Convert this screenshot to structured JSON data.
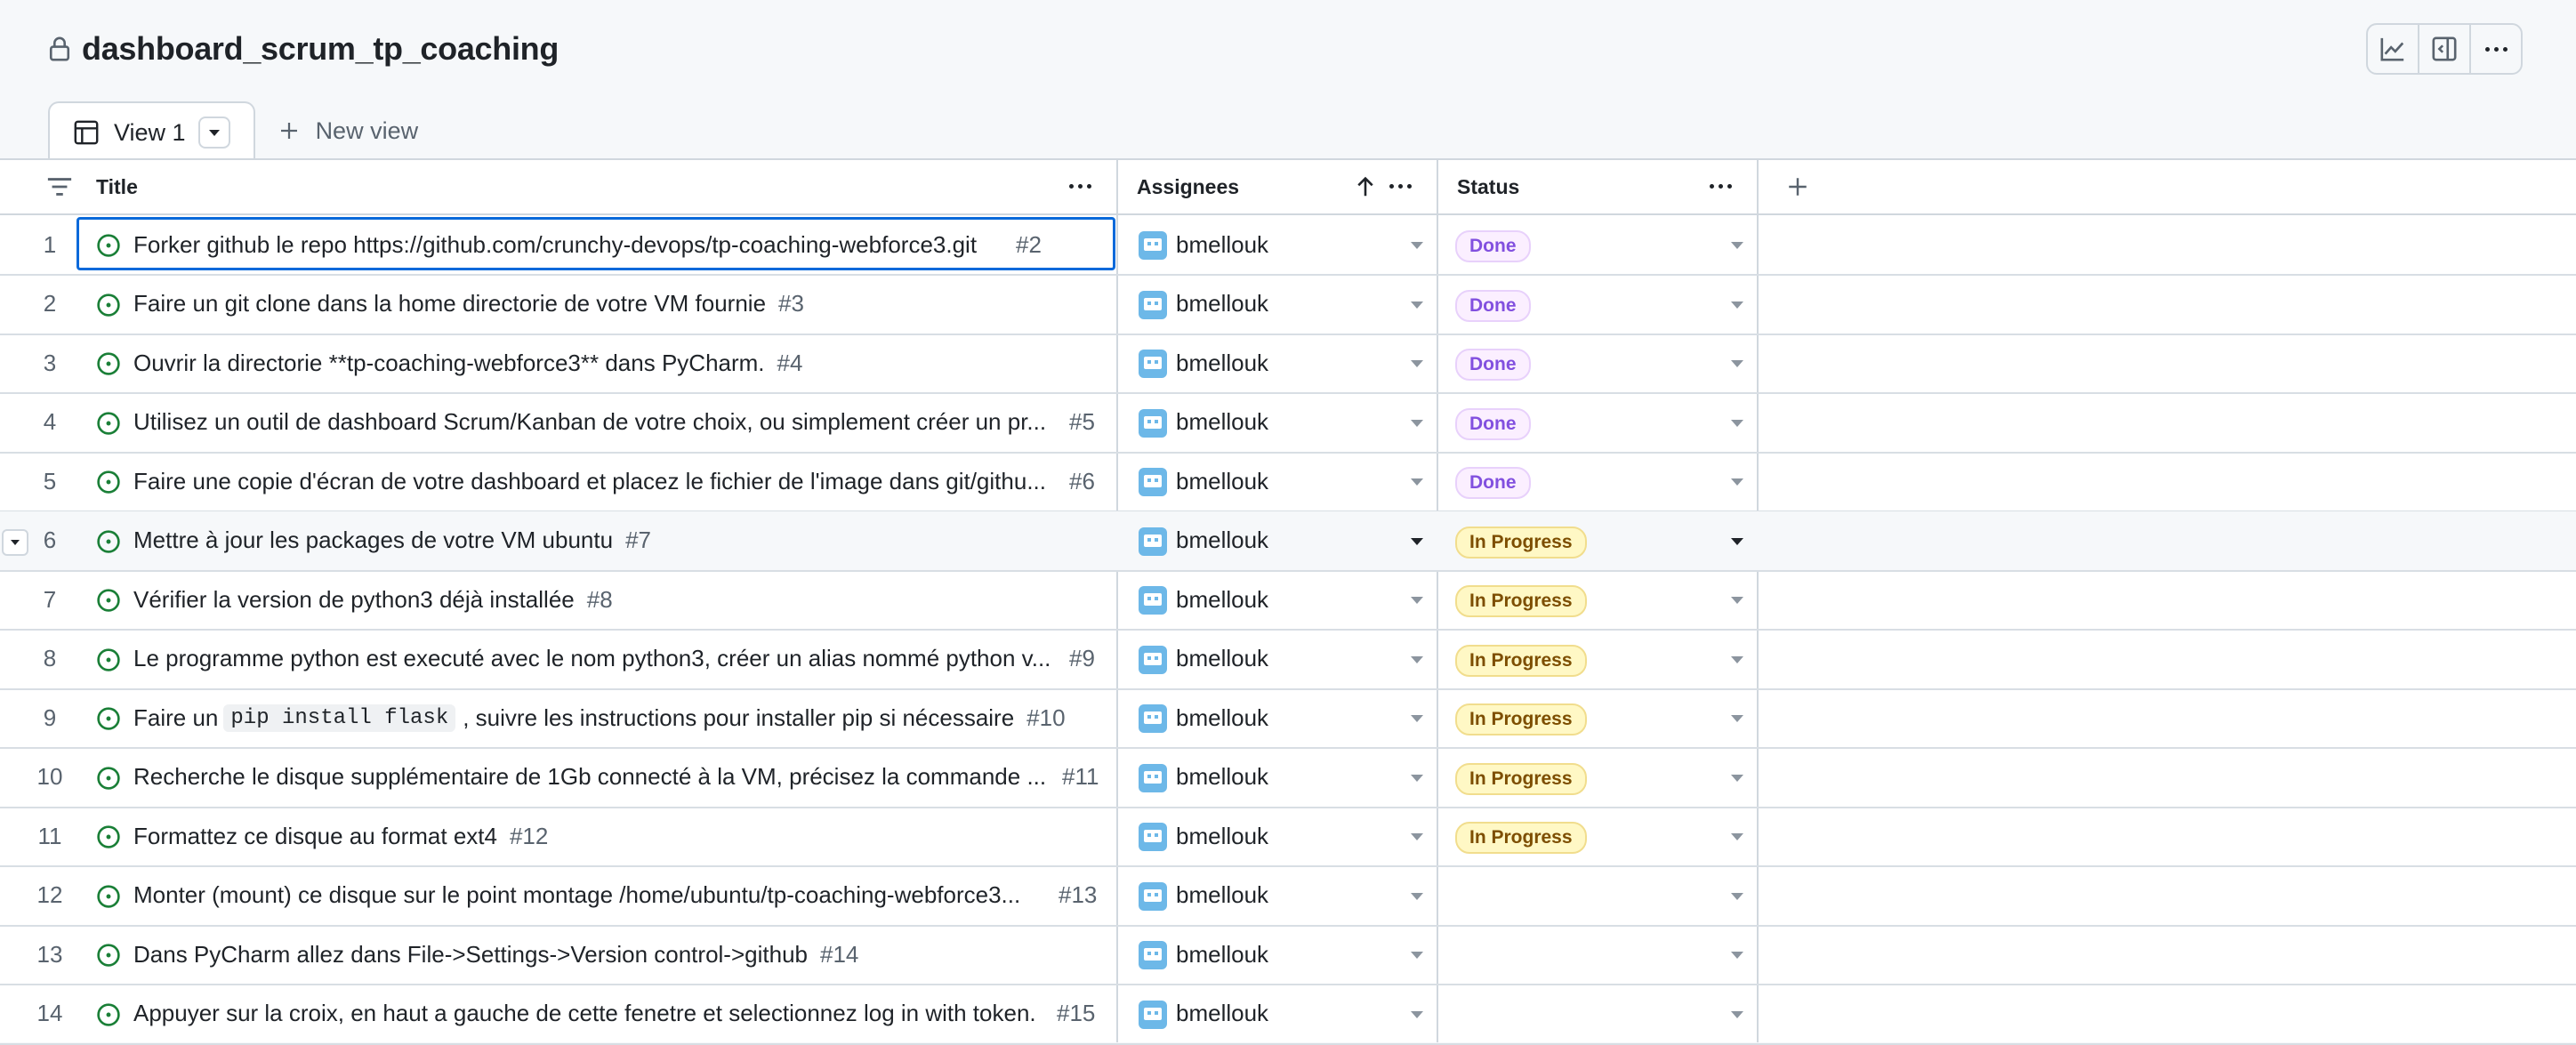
{
  "page": {
    "title": "dashboard_scrum_tp_coaching"
  },
  "tabs": {
    "view1_label": "View 1",
    "new_view_label": "New view"
  },
  "columns": {
    "title": "Title",
    "assignees": "Assignees",
    "status": "Status"
  },
  "colors": {
    "accent": "#0969da",
    "done": "#8250df",
    "in_progress": "#7d4e00",
    "open_issue": "#1a7f37"
  },
  "rows": [
    {
      "n": "1",
      "title": "Forker github le repo https://github.com/crunchy-devops/tp-coaching-webforce3.git",
      "issue": "#2",
      "assignee": "bmellouk",
      "status": "Done"
    },
    {
      "n": "2",
      "title": "Faire un git clone dans la home directorie de votre VM fournie",
      "issue": "#3",
      "assignee": "bmellouk",
      "status": "Done"
    },
    {
      "n": "3",
      "title": "Ouvrir la directorie **tp-coaching-webforce3** dans PyCharm.",
      "issue": "#4",
      "assignee": "bmellouk",
      "status": "Done"
    },
    {
      "n": "4",
      "title": "Utilisez un outil de dashboard Scrum/Kanban de votre choix, ou simplement créer un pr...",
      "issue": "#5",
      "assignee": "bmellouk",
      "status": "Done"
    },
    {
      "n": "5",
      "title": "Faire une copie d'écran de votre dashboard et placez le fichier de l'image dans git/githu...",
      "issue": "#6",
      "assignee": "bmellouk",
      "status": "Done"
    },
    {
      "n": "6",
      "title": "Mettre à jour les packages de votre VM ubuntu",
      "issue": "#7",
      "assignee": "bmellouk",
      "status": "In Progress"
    },
    {
      "n": "7",
      "title": "Vérifier la version de python3 déjà installée",
      "issue": "#8",
      "assignee": "bmellouk",
      "status": "In Progress"
    },
    {
      "n": "8",
      "title": "Le programme python est executé avec le nom python3, créer un alias nommé python v...",
      "issue": "#9",
      "assignee": "bmellouk",
      "status": "In Progress"
    },
    {
      "n": "9",
      "title_pre": "Faire un",
      "title_code": "pip install flask",
      "title_post": ", suivre les instructions pour installer pip si nécessaire",
      "issue": "#10",
      "assignee": "bmellouk",
      "status": "In Progress"
    },
    {
      "n": "10",
      "title": "Recherche le disque supplémentaire de 1Gb connecté à la VM, précisez la commande ...",
      "issue": "#11",
      "assignee": "bmellouk",
      "status": "In Progress"
    },
    {
      "n": "11",
      "title": "Formattez ce disque au format ext4",
      "issue": "#12",
      "assignee": "bmellouk",
      "status": "In Progress"
    },
    {
      "n": "12",
      "title": "Monter (mount) ce disque sur le point montage /home/ubuntu/tp-coaching-webforce3...",
      "issue": "#13",
      "assignee": "bmellouk",
      "status": ""
    },
    {
      "n": "13",
      "title": "Dans PyCharm allez dans File->Settings->Version control->github",
      "issue": "#14",
      "assignee": "bmellouk",
      "status": ""
    },
    {
      "n": "14",
      "title": "Appuyer sur la croix, en haut a gauche de cette fenetre et selectionnez log in with token.",
      "issue": "#15",
      "assignee": "bmellouk",
      "status": ""
    }
  ]
}
